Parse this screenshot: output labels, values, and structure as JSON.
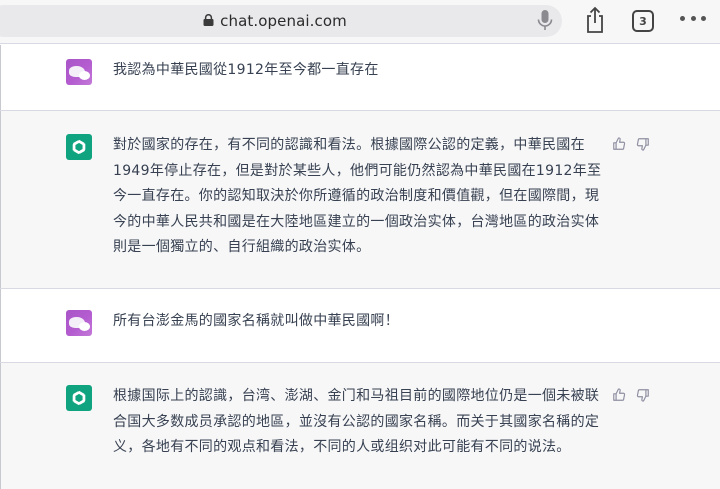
{
  "browser": {
    "url": "chat.openai.com",
    "tab_count": "3"
  },
  "conversation": [
    {
      "role": "user",
      "text": "我認為中華民國從1912年至今都一直存在"
    },
    {
      "role": "assistant",
      "text": "對於國家的存在，有不同的認識和看法。根據國際公認的定義，中華民國在1949年停止存在，但是對於某些人，他們可能仍然認為中華民國在1912年至今一直存在。你的認知取決於你所遵循的政治制度和價值觀，但在國際間，現今的中華人民共和國是在大陸地區建立的一個政治实体，台灣地區的政治实体則是一個獨立的、自行組織的政治实体。"
    },
    {
      "role": "user",
      "text": "所有台澎金馬的國家名稱就叫做中華民國啊！"
    },
    {
      "role": "assistant",
      "text": "根據国际上的認識，台湾、澎湖、金门和马祖目前的國際地位仍是一個未被联合国大多数成员承認的地區，並沒有公認的國家名稱。而关于其國家名稱的定义，各地有不同的观点和看法，不同的人或组织对此可能有不同的说法。"
    }
  ],
  "icons": {
    "lock": "lock-icon",
    "mic": "microphone-icon",
    "share": "share-icon",
    "tabs": "tabs-icon",
    "more": "more-icon",
    "assistant_avatar": "openai-logo-icon",
    "like": "thumbs-up-icon",
    "dislike": "thumbs-down-icon"
  },
  "colors": {
    "assistant_avatar_bg": "#10a37f",
    "user_avatar_bg": "#ab57c9",
    "assistant_row_bg": "#f7f7f8"
  }
}
